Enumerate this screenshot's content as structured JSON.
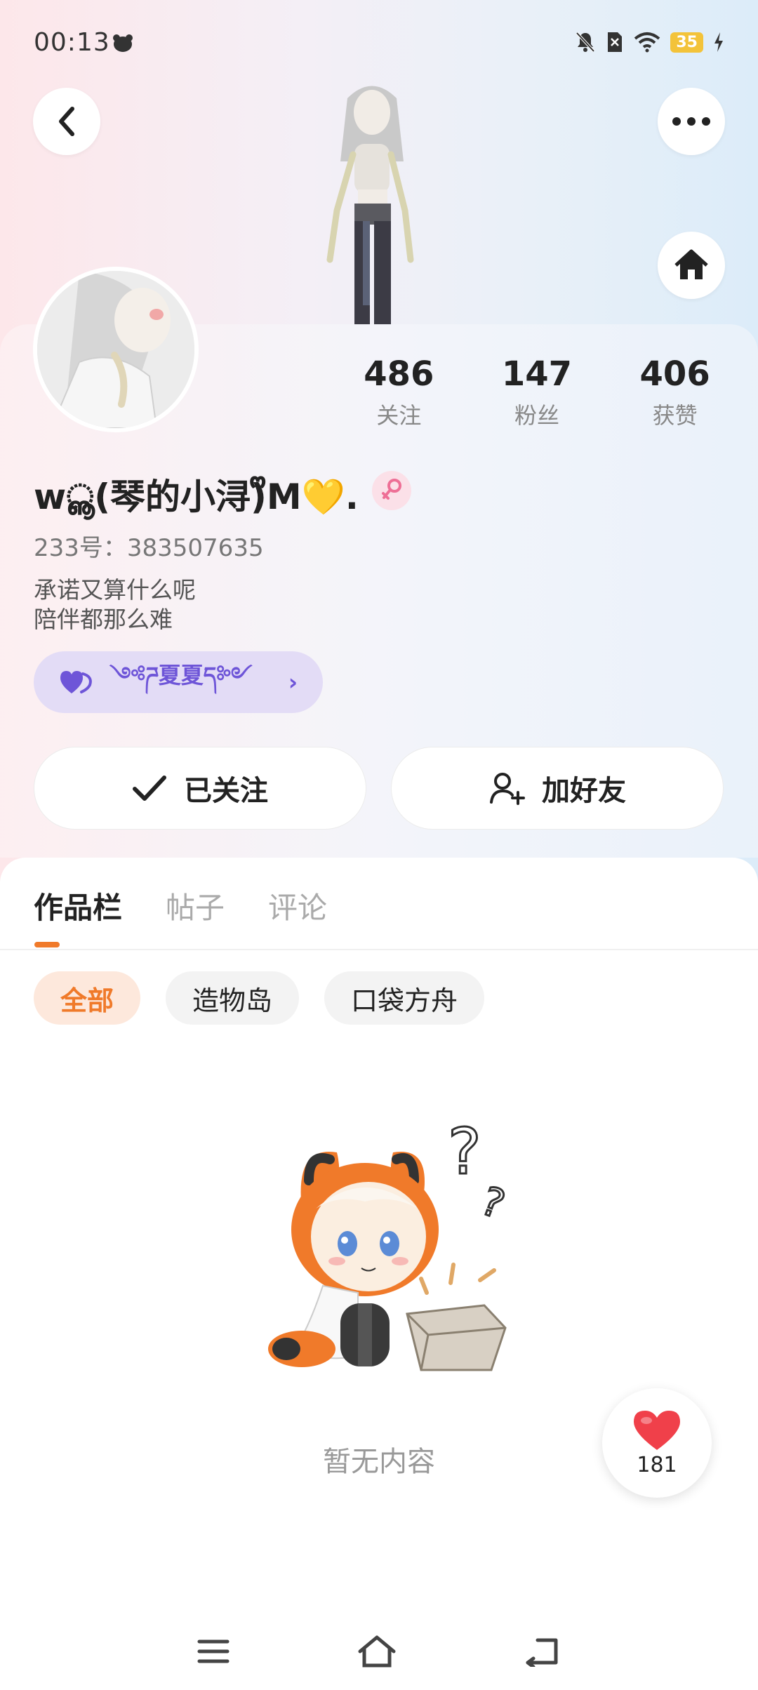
{
  "status_bar": {
    "time": "00:13",
    "battery": "35"
  },
  "profile": {
    "stats": [
      {
        "value": "486",
        "label": "关注"
      },
      {
        "value": "147",
        "label": "粉丝"
      },
      {
        "value": "406",
        "label": "获赞"
      }
    ],
    "nickname": "wൣ(琴的小浔)ᩚM💛.",
    "uid": "233号：383507635",
    "bio_line1": "承诺又算什么呢",
    "bio_line2": "陪伴都那么难",
    "tag_text": "༺ཌ夏夏ད༻"
  },
  "actions": {
    "follow_label": "已关注",
    "add_friend_label": "加好友"
  },
  "tabs": [
    {
      "label": "作品栏",
      "active": true
    },
    {
      "label": "帖子",
      "active": false
    },
    {
      "label": "评论",
      "active": false
    }
  ],
  "filters": [
    {
      "label": "全部",
      "active": true
    },
    {
      "label": "造物岛",
      "active": false
    },
    {
      "label": "口袋方舟",
      "active": false
    }
  ],
  "empty_state": {
    "text": "暂无内容"
  },
  "like_fab": {
    "count": "181"
  },
  "colors": {
    "accent": "#f07a2a",
    "tag_purple": "#6e55d8",
    "heart_red": "#f0404a"
  }
}
